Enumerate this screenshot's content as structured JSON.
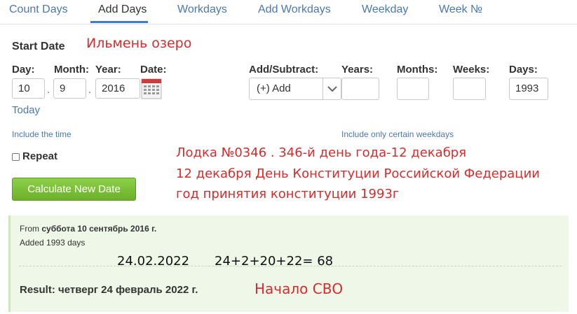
{
  "tabs": [
    {
      "label": "Count Days"
    },
    {
      "label": "Add Days"
    },
    {
      "label": "Workdays"
    },
    {
      "label": "Add Workdays"
    },
    {
      "label": "Weekday"
    },
    {
      "label": "Week №"
    }
  ],
  "start_date": {
    "heading": "Start Date",
    "annotation": "Ильмень озеро",
    "day_label": "Day:",
    "month_label": "Month:",
    "year_label": "Year:",
    "date_label": "Date:",
    "day_value": "10",
    "month_value": "9",
    "year_value": "2016",
    "separator": ".",
    "today_link": "Today",
    "include_time_link": "Include the time",
    "repeat_label": "Repeat"
  },
  "add_subtract": {
    "label": "Add/Subtract:",
    "selected": "(+) Add",
    "years_label": "Years:",
    "months_label": "Months:",
    "weeks_label": "Weeks:",
    "days_label": "Days:",
    "years_value": "",
    "months_value": "",
    "weeks_value": "",
    "days_value": "1993",
    "weekdays_link": "Include only certain weekdays"
  },
  "annotations": {
    "line1": "Лодка №0346 . 346-й день года-12 декабря",
    "line2": "12 декабря День Конституции Российской Федерации",
    "line3": "год принятия конституции 1993г",
    "date_note": "24.02.2022",
    "sum_note": "24+2+20+22= 68",
    "result_note": "Начало СВО"
  },
  "calculate_button": "Calculate New Date",
  "result": {
    "from_prefix": "From",
    "from_date": "суббота 10 сентябрь 2016 г.",
    "added": "Added 1993 days",
    "result_label": "Result: четверг 24 февраль 2022 г."
  },
  "colors": {
    "accent": "#3a7bd5",
    "link": "#4a78b5",
    "button_green": "#6cb12b",
    "annotation_red": "#d92b2b",
    "result_bg": "#eef7e8"
  }
}
